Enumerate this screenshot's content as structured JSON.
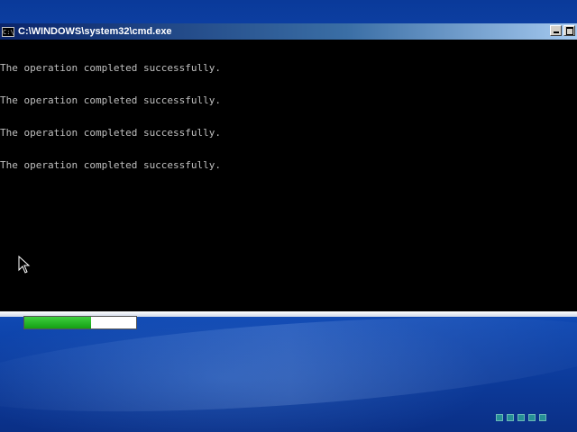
{
  "window": {
    "title": "C:\\WINDOWS\\system32\\cmd.exe",
    "icon_text": "C:\\"
  },
  "console": {
    "lines": [
      "The operation completed successfully.",
      "The operation completed successfully.",
      "The operation completed successfully.",
      "The operation completed successfully."
    ]
  },
  "progress": {
    "value_fraction": 0.6,
    "color": "#1aa51a"
  },
  "icons": {
    "cmd": "cmd-icon",
    "minimize": "minimize-icon",
    "maximize": "maximize-icon",
    "cursor": "mouse-cursor-icon",
    "tray": "progress-dots-icon"
  }
}
